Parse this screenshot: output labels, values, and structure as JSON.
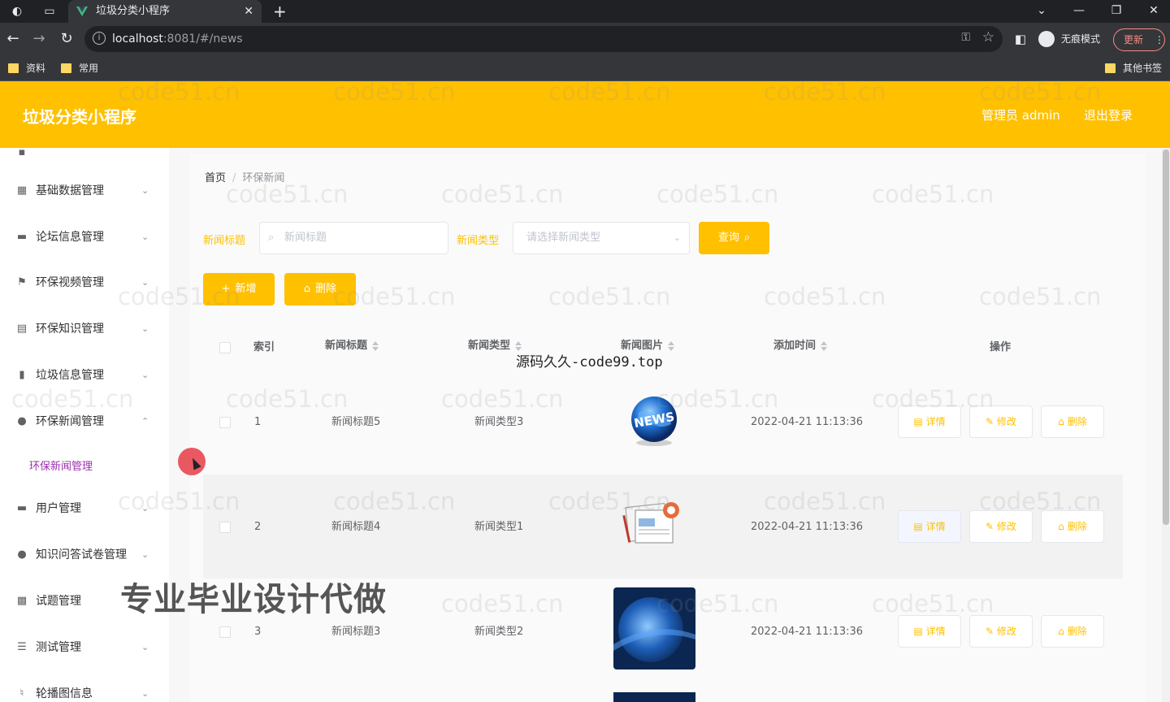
{
  "browser": {
    "tab_title": "垃圾分类小程序",
    "new_tab_symbol": "+",
    "url_host": "localhost",
    "url_rest": ":8081/#/news",
    "incognito_label": "无痕模式",
    "update_label": "更新",
    "bookmarks": [
      {
        "label": "资料"
      },
      {
        "label": "常用"
      }
    ],
    "other_bookmarks": "其他书签"
  },
  "header": {
    "title": "垃圾分类小程序",
    "admin": "管理员 admin",
    "logout": "退出登录"
  },
  "sidebar": {
    "items": [
      {
        "label": "基础数据管理",
        "icon": "grid-icon"
      },
      {
        "label": "论坛信息管理",
        "icon": "monitor-icon"
      },
      {
        "label": "环保视频管理",
        "icon": "flag-icon"
      },
      {
        "label": "环保知识管理",
        "icon": "document-icon"
      },
      {
        "label": "垃圾信息管理",
        "icon": "bar-chart-icon"
      },
      {
        "label": "环保新闻管理",
        "icon": "location-icon"
      },
      {
        "label": "用户管理",
        "icon": "chat-icon"
      },
      {
        "label": "知识问答试卷管理",
        "icon": "user-icon"
      },
      {
        "label": "试题管理",
        "icon": "film-icon"
      },
      {
        "label": "测试管理",
        "icon": "list-icon"
      },
      {
        "label": "轮播图信息",
        "icon": "microphone-icon"
      }
    ],
    "active_sub": "环保新闻管理"
  },
  "breadcrumb": {
    "home": "首页",
    "current": "环保新闻"
  },
  "filters": {
    "title_label": "新闻标题",
    "title_placeholder": "新闻标题",
    "type_label": "新闻类型",
    "type_placeholder": "请选择新闻类型",
    "query_button": "查询"
  },
  "actions": {
    "add": "新增",
    "delete": "删除"
  },
  "table": {
    "columns": [
      "索引",
      "新闻标题",
      "新闻类型",
      "新闻图片",
      "添加时间",
      "操作"
    ],
    "rows": [
      {
        "index": "1",
        "title": "新闻标题5",
        "type": "新闻类型3",
        "time": "2022-04-21 11:13:36"
      },
      {
        "index": "2",
        "title": "新闻标题4",
        "type": "新闻类型1",
        "time": "2022-04-21 11:13:36"
      },
      {
        "index": "3",
        "title": "新闻标题3",
        "type": "新闻类型2",
        "time": "2022-04-21 11:13:36"
      }
    ],
    "row_actions": {
      "detail": "详情",
      "edit": "修改",
      "delete": "删除"
    }
  },
  "overlays": {
    "watermark": "code51.cn",
    "source_text": "源码久久-code99.top",
    "ad_text": "专业毕业设计代做"
  },
  "colors": {
    "accent": "#ffc000",
    "active_sub": "#9c2fb0"
  }
}
